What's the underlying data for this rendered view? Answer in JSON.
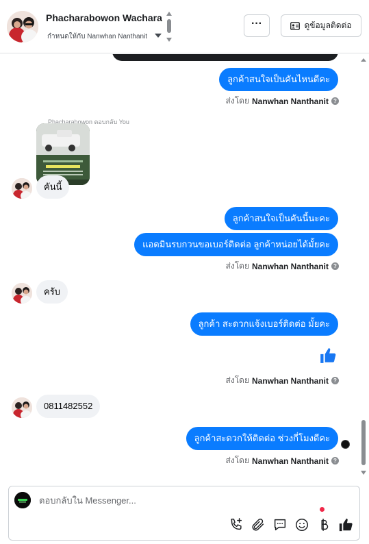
{
  "header": {
    "contact_name": "Phacharabowon Wachara",
    "assigned_to": "กำหนดให้กับ Nanwhan Nanthanit",
    "more_label": "···",
    "contact_info_label": "ดูข้อมูลติดต่อ"
  },
  "thread": {
    "messages_out_1": "ลูกค้าสนใจเป็นคันไหนดีคะ",
    "sent_by_prefix": "ส่งโดย",
    "sent_by_name": "Nanwhan Nanthanit",
    "reply_label": "Phacharabowon ตอบกลับ You",
    "msg_in_1": "คันนี้",
    "messages_out_2": "ลูกค้าสนใจเป็นคันนี้นะคะ",
    "messages_out_3": "แอดมินรบกวนขอเบอร์ติดต่อ ลูกค้าหน่อยได้มั้ยคะ",
    "msg_in_2": "ครับ",
    "messages_out_4": "ลูกค้า สะดวกแจ้งเบอร์ติดต่อ มั้ยคะ",
    "msg_in_3": "0811482552",
    "messages_out_5": "ลูกค้าสะดวกให้ติดต่อ ช่วงกี่โมงดีคะ"
  },
  "composer": {
    "placeholder": "ตอบกลับใน Messenger..."
  },
  "icons": [
    "phone-plus-icon",
    "paperclip-icon",
    "chat-bubble-icon",
    "emoji-icon",
    "baht-icon",
    "like-icon"
  ],
  "colors": {
    "outgoing_bubble": "#0a7cff",
    "incoming_bubble": "#f0f2f5",
    "like_blue": "#1877f2",
    "notification_red": "#f02849"
  }
}
